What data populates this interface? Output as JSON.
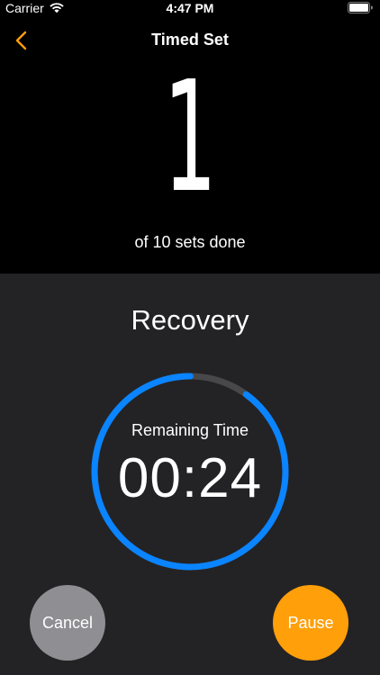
{
  "status_bar": {
    "carrier": "Carrier",
    "time": "4:47 PM"
  },
  "nav": {
    "title": "Timed Set",
    "back_icon": "chevron-left-icon"
  },
  "progress": {
    "completed_sets": "1",
    "sets_label": "of 10 sets done"
  },
  "timer": {
    "phase": "Recovery",
    "remaining_label": "Remaining Time",
    "remaining_time": "00:24",
    "remaining_fraction": 0.9
  },
  "buttons": {
    "cancel_label": "Cancel",
    "pause_label": "Pause"
  },
  "colors": {
    "accent": "#ff9f0a",
    "ring_progress": "#0a84ff",
    "ring_track": "#48484a",
    "cancel": "#8e8e93",
    "background_top": "#000000",
    "background_bottom": "#232325"
  }
}
